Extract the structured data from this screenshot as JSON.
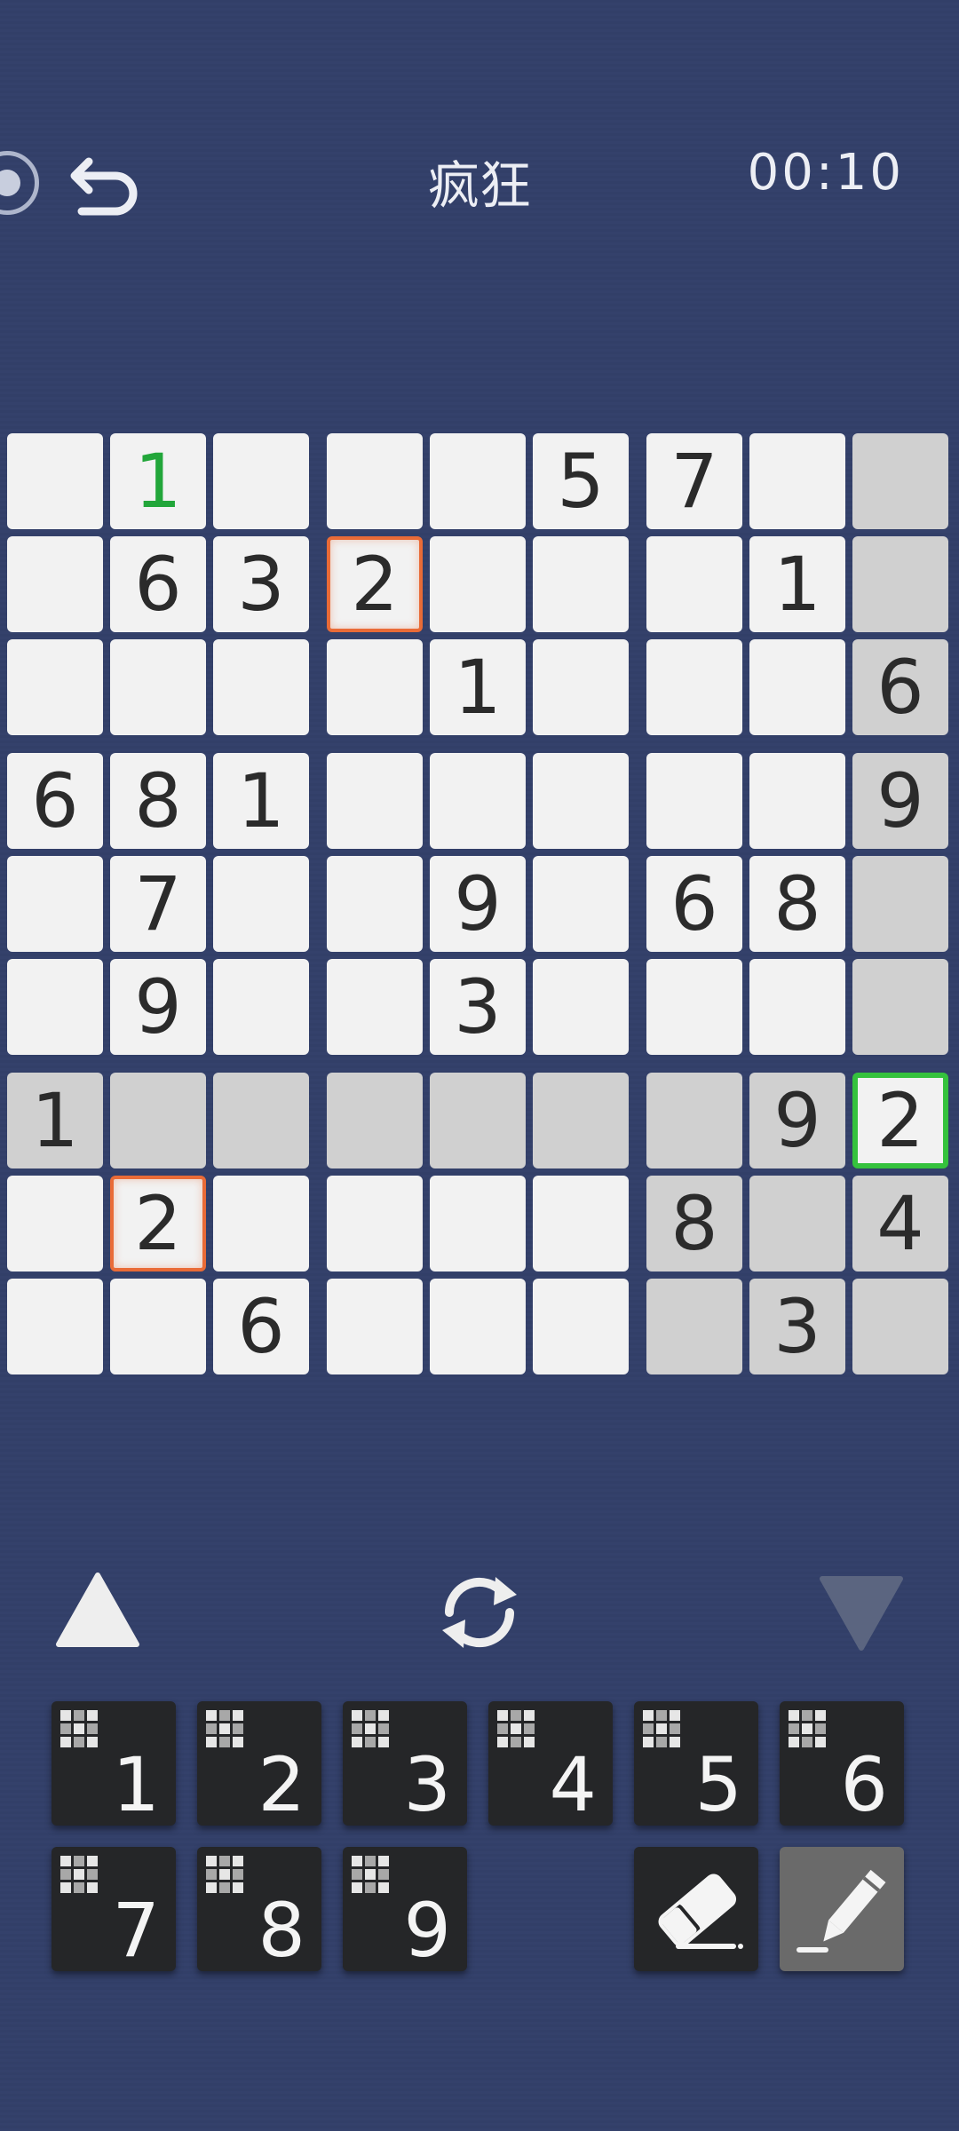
{
  "header": {
    "title": "疯狂",
    "timer": "00:10"
  },
  "board": {
    "rows": [
      [
        "",
        "1",
        "",
        "",
        "",
        "5",
        "7",
        "",
        ""
      ],
      [
        "",
        "6",
        "3",
        "2",
        "",
        "",
        "",
        "1",
        ""
      ],
      [
        "",
        "",
        "",
        "",
        "1",
        "",
        "",
        "",
        "6"
      ],
      [
        "6",
        "8",
        "1",
        "",
        "",
        "",
        "",
        "",
        "9"
      ],
      [
        "",
        "7",
        "",
        "",
        "9",
        "",
        "6",
        "8",
        ""
      ],
      [
        "",
        "9",
        "",
        "",
        "3",
        "",
        "",
        "",
        ""
      ],
      [
        "1",
        "",
        "",
        "",
        "",
        "",
        "",
        "9",
        "2"
      ],
      [
        "",
        "2",
        "",
        "",
        "",
        "",
        "8",
        "",
        "4"
      ],
      [
        "",
        "",
        "6",
        "",
        "",
        "",
        "",
        "3",
        ""
      ]
    ],
    "highlighted_cells": [
      [
        0,
        8
      ],
      [
        1,
        8
      ],
      [
        2,
        8
      ],
      [
        3,
        8
      ],
      [
        4,
        8
      ],
      [
        5,
        8
      ],
      [
        6,
        0
      ],
      [
        6,
        1
      ],
      [
        6,
        2
      ],
      [
        6,
        3
      ],
      [
        6,
        4
      ],
      [
        6,
        5
      ],
      [
        6,
        6
      ],
      [
        6,
        7
      ],
      [
        6,
        8
      ],
      [
        7,
        6
      ],
      [
        7,
        7
      ],
      [
        7,
        8
      ],
      [
        8,
        6
      ],
      [
        8,
        7
      ],
      [
        8,
        8
      ]
    ],
    "selected_cell": [
      6,
      8
    ],
    "conflict_cells": [
      [
        1,
        3
      ],
      [
        7,
        1
      ]
    ],
    "user_entered_cells": [
      [
        0,
        1
      ]
    ],
    "colors": {
      "cell": "#f2f2f2",
      "highlight": "#d0d0d0",
      "selected_border": "#35c23d",
      "conflict_border": "#e96b37",
      "user_digit": "#22a63a",
      "background": "#323f68"
    }
  },
  "controls": {
    "up_icon": "triangle-up-icon",
    "refresh_icon": "refresh-icon",
    "down_icon": "triangle-down-icon"
  },
  "keypad": {
    "digits": [
      "1",
      "2",
      "3",
      "4",
      "5",
      "6",
      "7",
      "8",
      "9"
    ],
    "eraser_icon": "eraser-icon",
    "pencil_icon": "pencil-icon"
  }
}
